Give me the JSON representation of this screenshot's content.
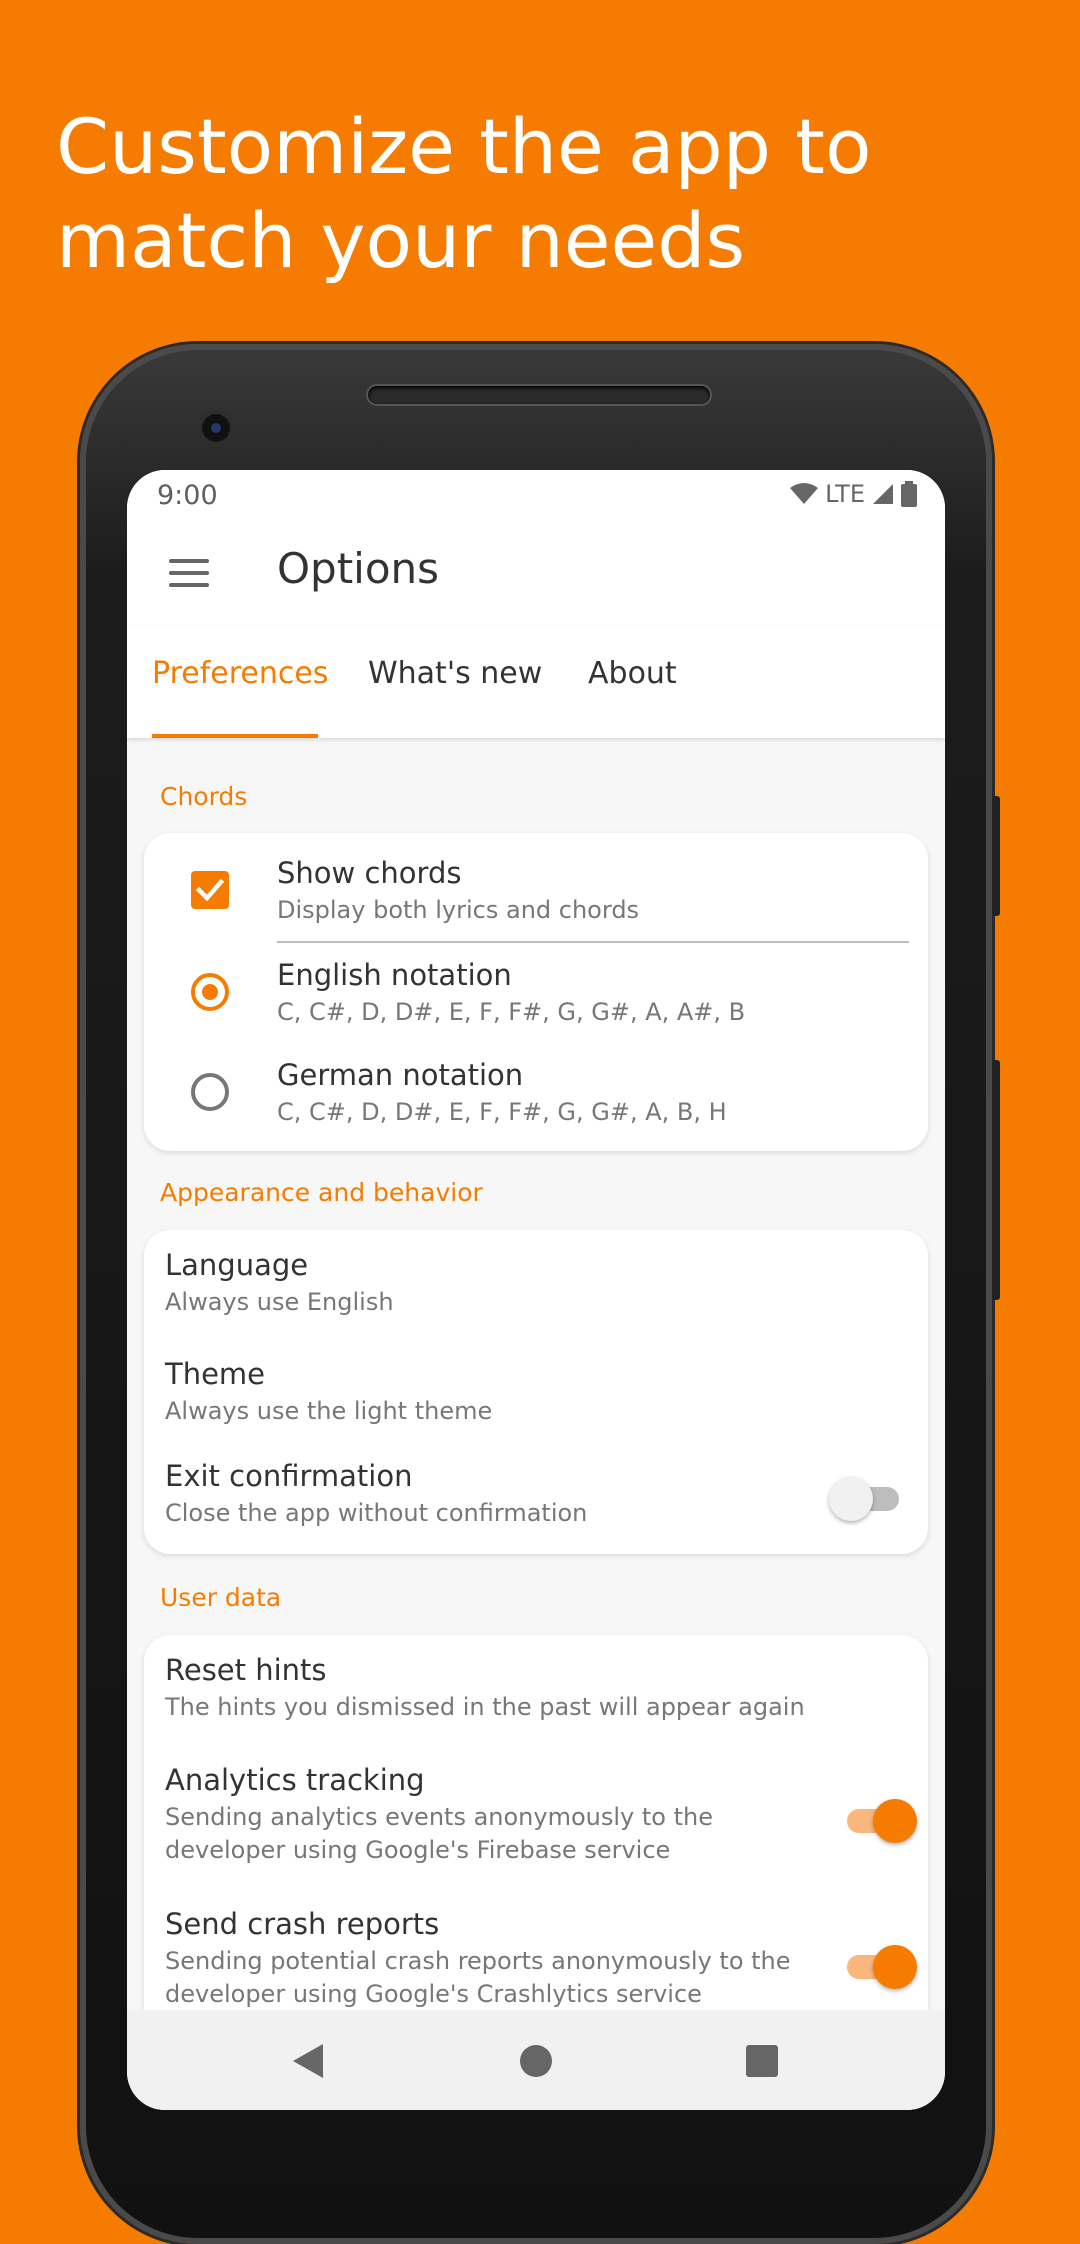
{
  "headline": {
    "line1": "Customize the app to",
    "line2": "match your needs"
  },
  "status_bar": {
    "time": "9:00",
    "network": "LTE"
  },
  "app_bar": {
    "title": "Options"
  },
  "tabs": [
    {
      "label": "Preferences",
      "active": true
    },
    {
      "label": "What's new",
      "active": false
    },
    {
      "label": "About",
      "active": false
    }
  ],
  "sections": {
    "chords": {
      "header": "Chords",
      "show_chords": {
        "title": "Show chords",
        "subtitle": "Display both lyrics and chords",
        "checked": true
      },
      "english_notation": {
        "title": "English notation",
        "subtitle": "C, C#, D, D#, E, F, F#, G, G#, A, A#, B",
        "selected": true
      },
      "german_notation": {
        "title": "German notation",
        "subtitle": "C, C#, D, D#, E, F, F#, G, G#, A, B, H",
        "selected": false
      }
    },
    "appearance": {
      "header": "Appearance and behavior",
      "language": {
        "title": "Language",
        "subtitle": "Always use English"
      },
      "theme": {
        "title": "Theme",
        "subtitle": "Always use the light theme"
      },
      "exit_confirmation": {
        "title": "Exit confirmation",
        "subtitle": "Close the app without confirmation",
        "enabled": false
      }
    },
    "user_data": {
      "header": "User data",
      "reset_hints": {
        "title": "Reset hints",
        "subtitle": "The hints you dismissed in the past will appear again"
      },
      "analytics": {
        "title": "Analytics tracking",
        "subtitle_line1": "Sending analytics events anonymously to the",
        "subtitle_line2": "developer using Google's Firebase service",
        "enabled": true
      },
      "crash_reports": {
        "title": "Send crash reports",
        "subtitle_line1": "Sending potential crash reports anonymously to the",
        "subtitle_line2": "developer using Google's Crashlytics service",
        "enabled": true
      }
    }
  },
  "colors": {
    "accent": "#F57C00",
    "background": "#F57C00"
  }
}
